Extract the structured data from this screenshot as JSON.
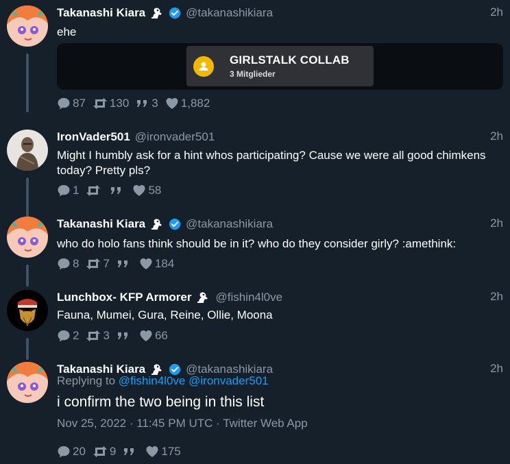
{
  "tweets": [
    {
      "name": "Takanashi Kiara",
      "handle": "@takanashikiara",
      "time": "2h",
      "text": "ehe",
      "embed": {
        "group_name": "GIRLSTALK COLLAB",
        "members": "3 Mitglieder"
      },
      "replies": "87",
      "retweets": "130",
      "quotes": "3",
      "likes": "1,882"
    },
    {
      "name": "IronVader501",
      "handle": "@ironvader501",
      "time": "2h",
      "text": "Might I humbly ask for a hint whos participating? Cause we were all good chimkens today? Pretty pls?",
      "replies": "1",
      "retweets": "",
      "quotes": "",
      "likes": "58"
    },
    {
      "name": "Takanashi Kiara",
      "handle": "@takanashikiara",
      "time": "2h",
      "text": "who do holo fans think should be in it? who do they consider girly? :amethink:",
      "replies": "8",
      "retweets": "7",
      "quotes": "",
      "likes": "184"
    },
    {
      "name": "Lunchbox- KFP Armorer",
      "handle": "@fishin4l0ve",
      "time": "2h",
      "text": "Fauna, Mumei, Gura, Reine, Ollie, Moona",
      "replies": "2",
      "retweets": "3",
      "quotes": "",
      "likes": "66"
    },
    {
      "name": "Takanashi Kiara",
      "handle": "@takanashikiara",
      "time": "2h",
      "replying_label": "Replying to",
      "replying_to": [
        "@fishin4l0ve",
        "@ironvader501"
      ],
      "text": "i confirm the two being in this list",
      "date": "Nov 25, 2022 · 11:45 PM UTC · Twitter Web App",
      "replies": "20",
      "retweets": "9",
      "quotes": "",
      "likes": "175"
    }
  ],
  "colors": {
    "background": "#15202b",
    "secondary_text": "#8b98a5",
    "link": "#1d9bf0",
    "verified": "#1d9bf0",
    "thread_line": "#3d5466"
  }
}
